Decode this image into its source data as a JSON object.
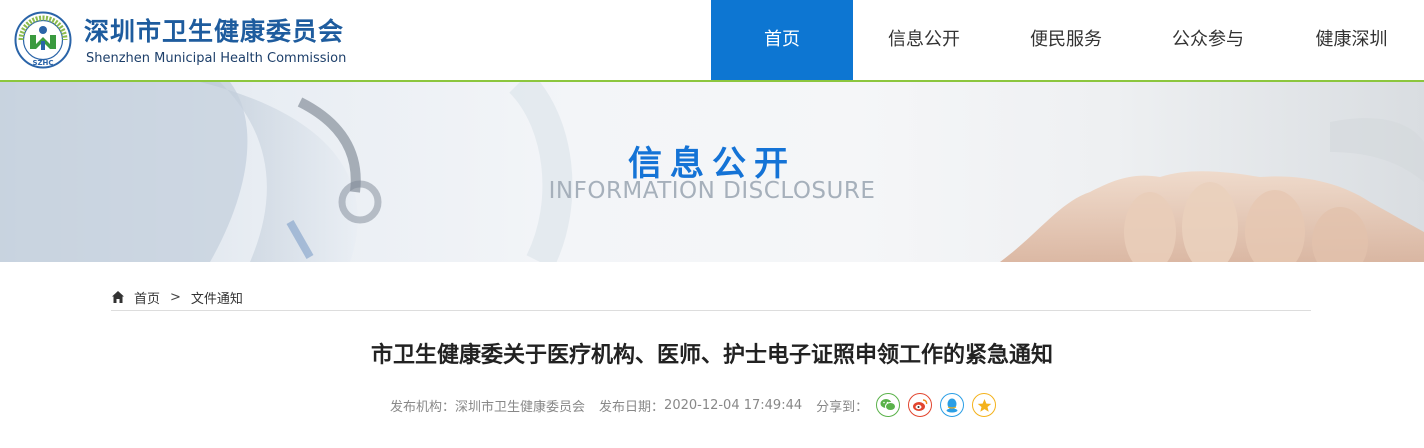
{
  "header": {
    "site_name_cn": "深圳市卫生健康委员会",
    "site_name_en": "Shenzhen Municipal Health Commission",
    "logo": {
      "ring_text": "深圳市卫生健康委员会",
      "abbr": "SZHC"
    }
  },
  "nav": {
    "items": [
      {
        "label": "首页",
        "active": true
      },
      {
        "label": "信息公开",
        "active": false
      },
      {
        "label": "便民服务",
        "active": false
      },
      {
        "label": "公众参与",
        "active": false
      },
      {
        "label": "健康深圳",
        "active": false
      }
    ]
  },
  "banner": {
    "title": "信息公开",
    "subtitle": "INFORMATION DISCLOSURE"
  },
  "breadcrumb": {
    "home": "首页",
    "separator": ">",
    "current": "文件通知"
  },
  "article": {
    "title": "市卫生健康委关于医疗机构、医师、护士电子证照申领工作的紧急通知",
    "publisher_label": "发布机构：",
    "publisher": "深圳市卫生健康委员会",
    "date_label": "发布日期：",
    "date": "2020-12-04 17:49:44",
    "share_label": "分享到："
  },
  "share": {
    "icons": [
      "wechat-icon",
      "weibo-icon",
      "qq-icon",
      "qzone-icon"
    ]
  },
  "colors": {
    "brand_blue": "#0d76d2",
    "nav_active": "#0d76d2",
    "header_rule": "#8cc63e",
    "logo_green": "#3a9a3f"
  }
}
